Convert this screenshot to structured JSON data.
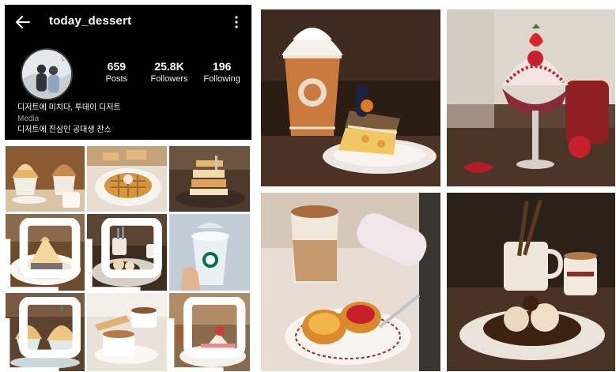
{
  "profile": {
    "username": "today_dessert",
    "stats": [
      {
        "value": "659",
        "label": "Posts"
      },
      {
        "value": "25.8K",
        "label": "Followers"
      },
      {
        "value": "196",
        "label": "Following"
      }
    ],
    "bio": {
      "name": "디저트에 미치다, 투데이 디저트",
      "category": "Media",
      "description": "디저트에 진심인 공대생 찬스"
    },
    "icons": {
      "back": "arrow-left-icon",
      "more": "more-vertical-icon"
    }
  },
  "grid_posts": [
    {
      "subject": "ice-cream-cups-with-coffee",
      "multi": false
    },
    {
      "subject": "waffle-plate",
      "multi": false
    },
    {
      "subject": "stacked-pastry-tower",
      "multi": false
    },
    {
      "subject": "cheesecake-slice",
      "multi": true
    },
    {
      "subject": "brownie-plate-with-coffee",
      "multi": true
    },
    {
      "subject": "starbucks-frappuccino-in-hand",
      "multi": false
    },
    {
      "subject": "bingsu-cups",
      "multi": true
    },
    {
      "subject": "coffee-cups-and-biscuit",
      "multi": false
    },
    {
      "subject": "strawberry-cake-slice",
      "multi": true
    }
  ],
  "featured_photos": [
    {
      "subject": "starbucks-frappuccino-and-cake"
    },
    {
      "subject": "strawberry-parfait-glass"
    },
    {
      "subject": "latte-and-egg-tarts"
    },
    {
      "subject": "coffee-mugs-and-brownie-dessert"
    }
  ],
  "colors": {
    "profile_background": "#000000",
    "text_primary": "#ffffff",
    "text_secondary": "#a8a8a8",
    "cream": "#f4ece0",
    "coffee": "#7a4a28",
    "strawberry": "#c8202a"
  }
}
